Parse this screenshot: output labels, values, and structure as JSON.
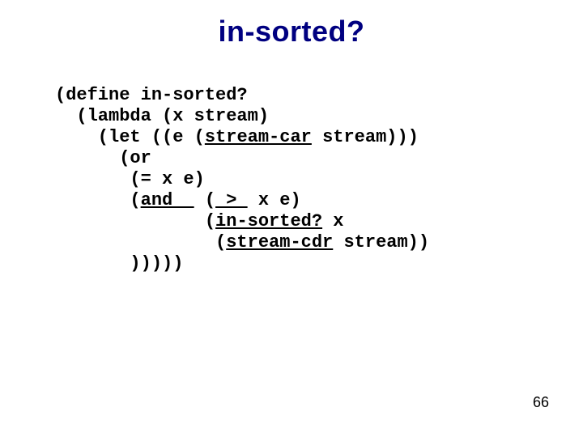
{
  "title": "in-sorted?",
  "code": {
    "l1a": "(define in-sorted?",
    "l2a": "  (lambda (x stream)",
    "l3a": "    (let ((e (",
    "l3u": "stream-car",
    "l3b": " stream)))",
    "l4a": "      (or",
    "l5a": "       (= x e)",
    "l6a": "       (",
    "l6u1": "and  ",
    "l6b": " (",
    "l6u2": " > ",
    "l6c": " x e)",
    "l7a": "              (",
    "l7u": "in-sorted?",
    "l7b": " x",
    "l8a": "               (",
    "l8u": "stream-cdr",
    "l8b": " stream))",
    "l9a": "       )))))"
  },
  "page": "66"
}
